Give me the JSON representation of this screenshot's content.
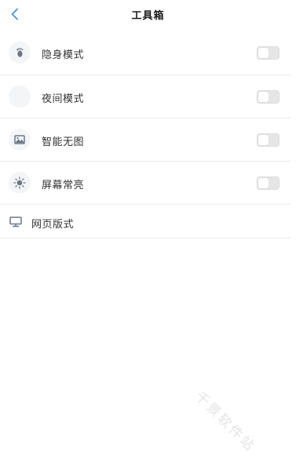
{
  "header": {
    "title": "工具箱"
  },
  "menu": {
    "items": [
      {
        "label": "隐身模式",
        "icon": "footprint-icon",
        "enabled": false
      },
      {
        "label": "夜间模式",
        "icon": "moon-icon",
        "enabled": false
      },
      {
        "label": "智能无图",
        "icon": "image-icon",
        "enabled": false
      },
      {
        "label": "屏幕常亮",
        "icon": "sun-icon",
        "enabled": false
      }
    ],
    "web_layout": {
      "label": "网页版式",
      "icon": "monitor-icon"
    }
  },
  "watermark": "千景软件站",
  "colors": {
    "accent": "#4a90e2",
    "icon": "#6b7785",
    "toggle_off": "#e6e6e6"
  }
}
